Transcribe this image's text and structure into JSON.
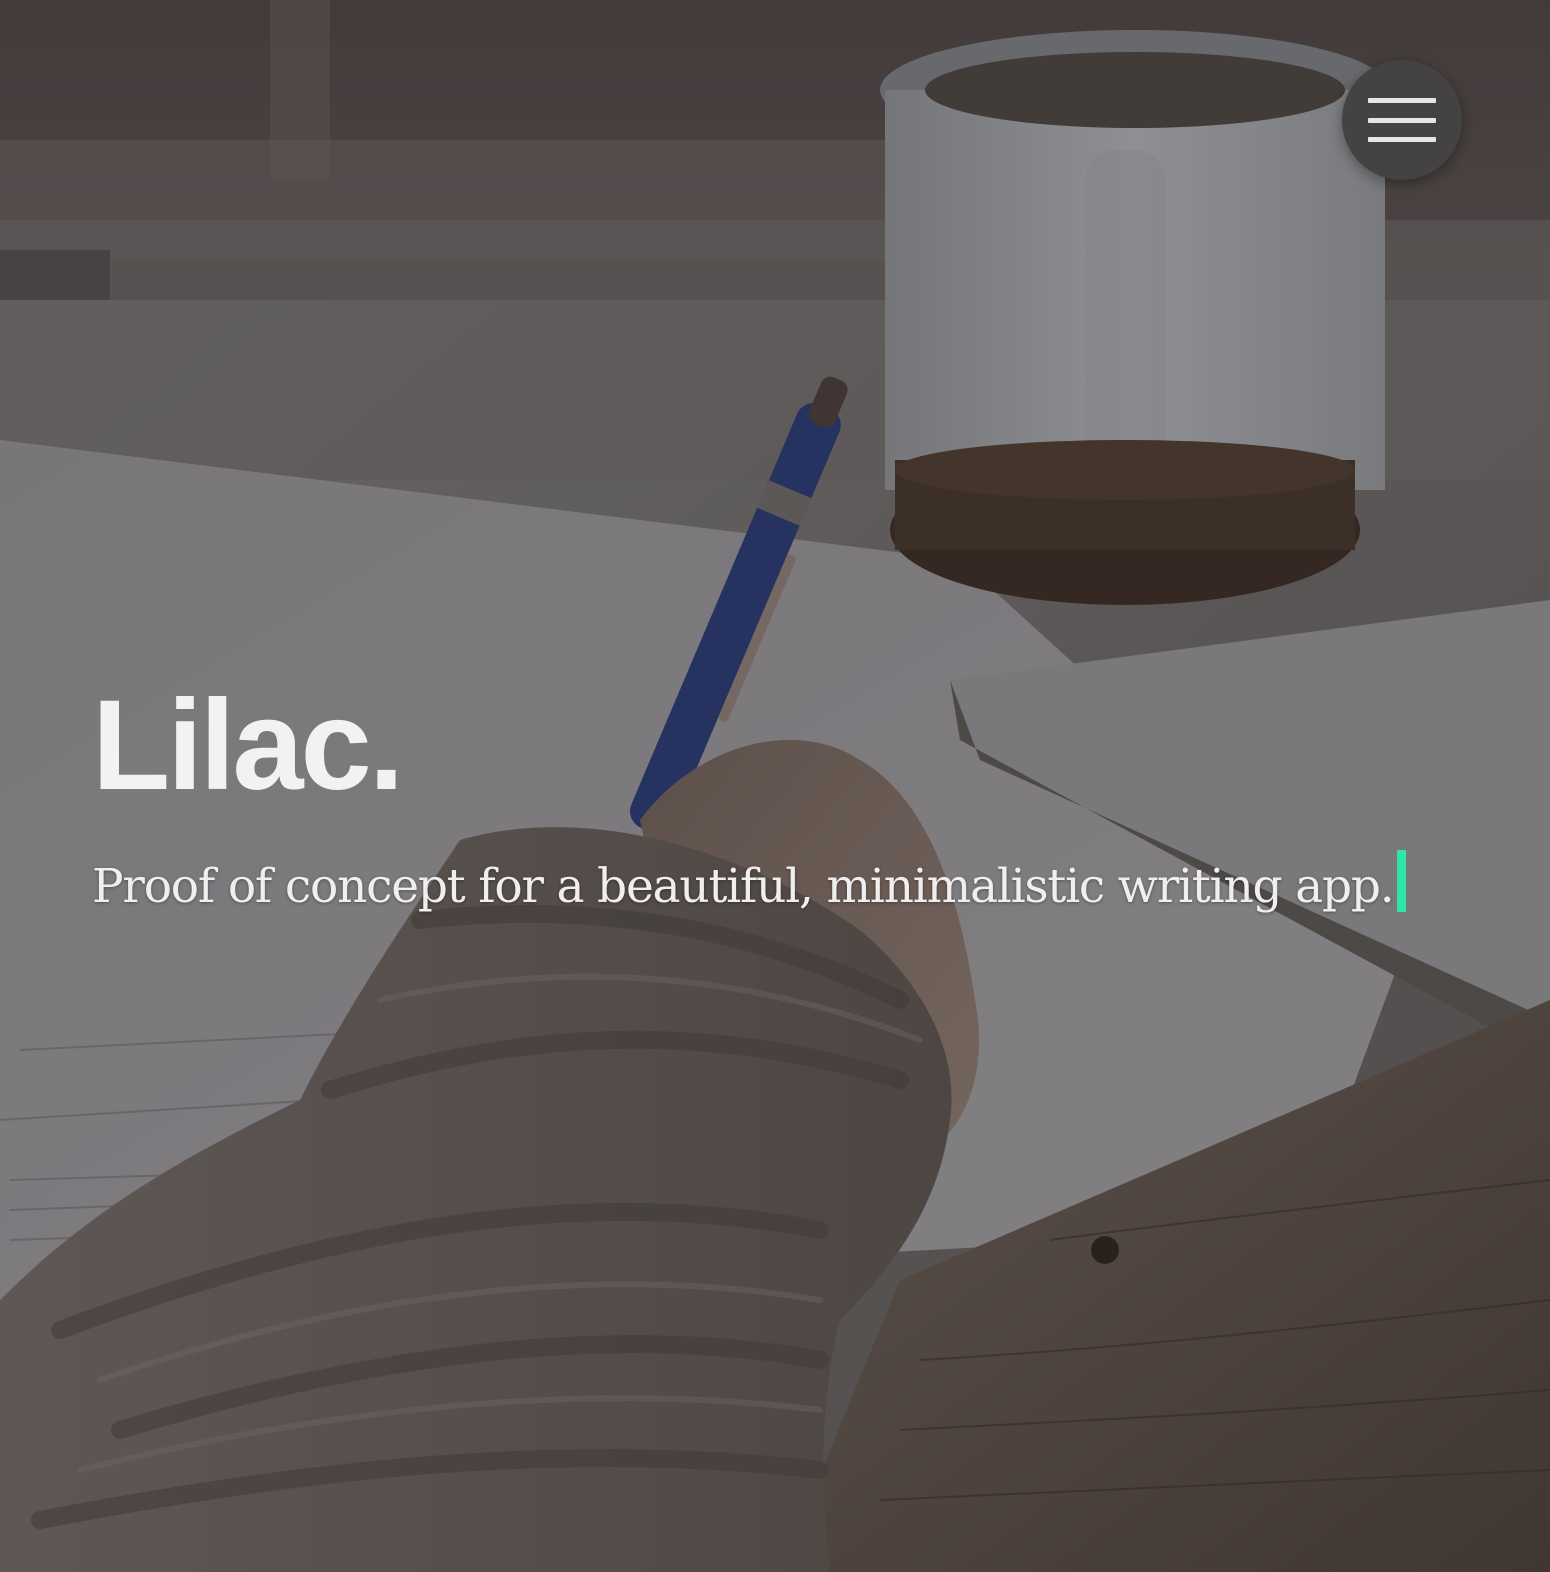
{
  "hero": {
    "title": "Lilac.",
    "subtitle": "Proof of concept for a beautiful, minimalistic writing app.",
    "caret_color": "#2ee6a6",
    "background_image": "person writing in notebook with pen, coffee mug on desk"
  },
  "menu": {
    "icon": "hamburger-menu-icon"
  }
}
